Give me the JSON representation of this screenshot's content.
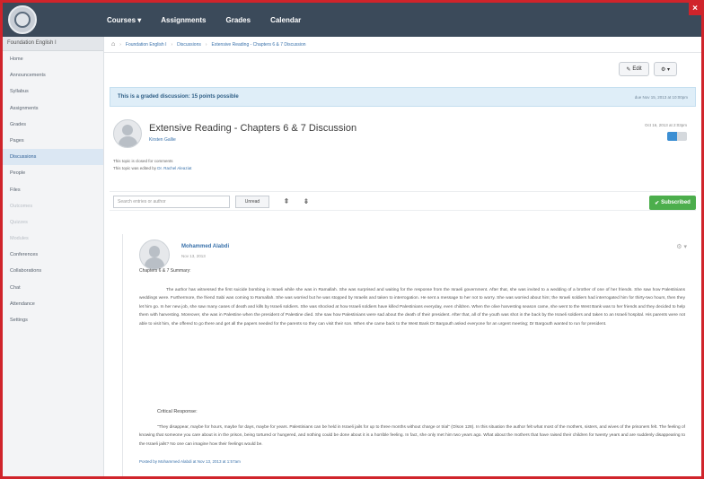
{
  "nav": {
    "items": [
      "Courses ▾",
      "Assignments",
      "Grades",
      "Calendar"
    ]
  },
  "sidebar": {
    "course_title": "Foundation English I",
    "items": [
      {
        "label": "Home"
      },
      {
        "label": "Announcements"
      },
      {
        "label": "Syllabus"
      },
      {
        "label": "Assignments"
      },
      {
        "label": "Grades"
      },
      {
        "label": "Pages"
      },
      {
        "label": "Discussions",
        "active": true
      },
      {
        "label": "People"
      },
      {
        "label": "Files"
      },
      {
        "label": "Outcomes",
        "muted": true
      },
      {
        "label": "Quizzes",
        "muted": true
      },
      {
        "label": "Modules",
        "muted": true
      },
      {
        "label": "Conferences"
      },
      {
        "label": "Collaborations"
      },
      {
        "label": "Chat"
      },
      {
        "label": "Attendance"
      },
      {
        "label": "Settings"
      }
    ]
  },
  "breadcrumb": {
    "items": [
      "Foundation English I",
      "Discussions",
      "Extensive Reading - Chapters 6 & 7 Discussion"
    ]
  },
  "toolbar": {
    "edit_label": "Edit",
    "gear_label": "⚙ ▾"
  },
  "notice": {
    "message": "This is a graded discussion: 15 points possible",
    "due": "due Nov 15, 2013 at 10:00pm"
  },
  "topic": {
    "title": "Extensive Reading - Chapters 6 & 7 Discussion",
    "author": "Kirsten Gallie",
    "date": "Oct 16, 2013 at 2:03pm",
    "closed_note": "This topic is closed for comments",
    "author_note_prefix": "This topic was edited by",
    "author_note_name": "Dr. Rachel Aleaziat"
  },
  "filter": {
    "search_placeholder": "Search entries or author",
    "unread_label": "Unread",
    "subscribed_label": "Subscribed"
  },
  "reply": {
    "author": "Mohammed Alabdi",
    "date": "Nov 13, 2013",
    "subheading": "Chapters 6 & 7 Summary:",
    "paragraph1": "The author has witnessed the first suicide bombing in Israeli while she was in Ramallah. She was surprised and waiting for the response from the Israeli government. After that, she was invited to a wedding of a brother of one of her friends. She saw how Palestinians weddings were. Furthermore, the friend Sabi was coming to Ramallah. She was worried but he was stopped by Israelis and taken to interrogation. He sent a message to her not to worry. She was worried about him; the Israeli soldiers had interrogated him for thirty-two hours, then they let him go. In her new job, she saw many cases of death and kills by Israeli soldiers. She was shocked at how Israeli soldiers have killed Palestinians everyday, even children. When the olive harvesting season came, she went to the West Bank was to her friends and they decided to help them with harvesting. Moreover, she was in Palestine when the president of Palestine died. She saw how Palestinians were sad about the death of their president. After that, all of the youth was shot in the back by the Israeli soldiers and taken to an Israeli hospital. His parents were not able to visit him, she offered to go there and get all the papers needed for the parents so they can visit their son. When she came back to the West Bank Dr Bargouth asked everyone for an urgent meeting; Dr Bargouth wanted to run for president.",
    "critical_heading": "Critical Response:",
    "paragraph2": "“They disappear, maybe for hours, maybe for days, maybe for years. Palestinians can be held in Israeli jails for up to three months without charge or trial” (Olson 128). In this situation the author felt what most of the mothers, sisters, and wives of the prisoners felt. The feeling of knowing that someone you care about is in the prison, being tortured or hungered, and nothing could be done about it is a horrible feeling. In fact, she only met him two years ago. What about the mothers that have raised their children for twenty years and are suddenly disappearing to the Israeli jails? No one can imagine how their feelings would be.",
    "posted_by": "Posted by Mohammed Alabdi at Nov 13, 2013 at 1:57am"
  }
}
